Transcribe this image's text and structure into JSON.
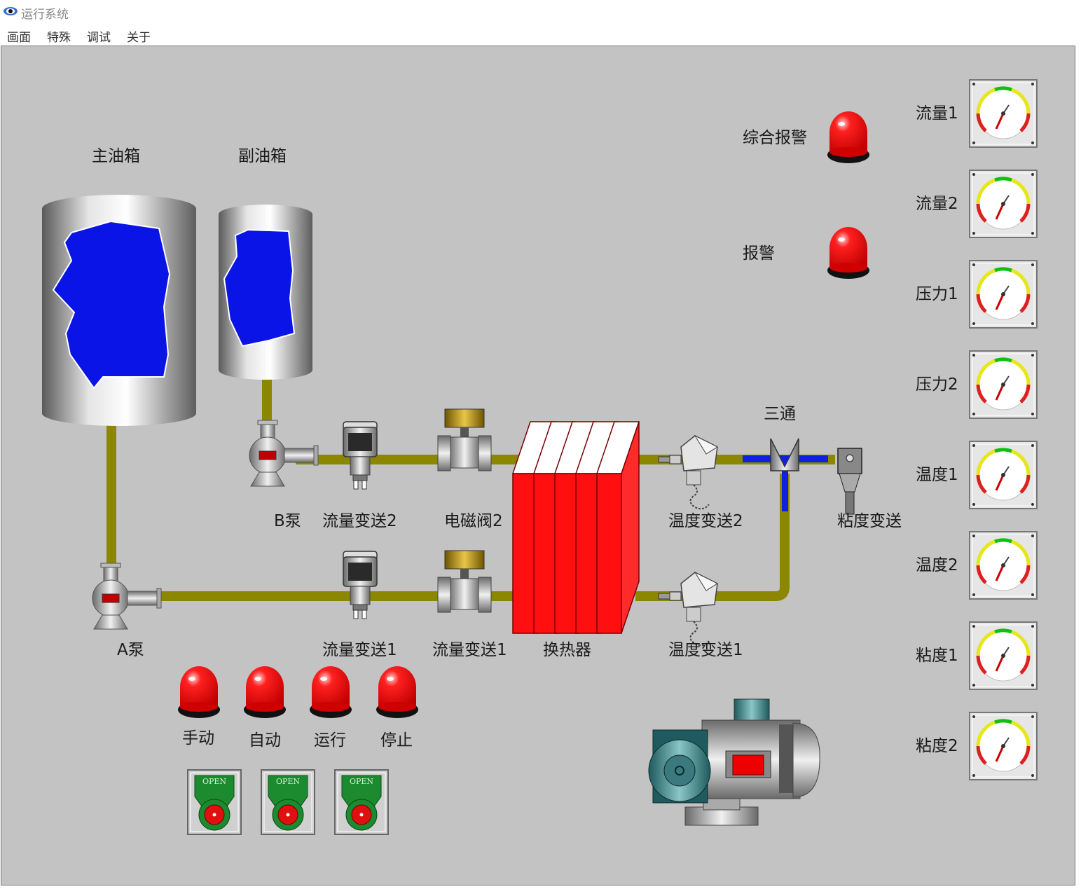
{
  "window": {
    "title": "运行系统"
  },
  "menu": [
    "画面",
    "特殊",
    "调试",
    "关于"
  ],
  "tanks": {
    "main": "主油箱",
    "secondary": "副油箱"
  },
  "pumps": {
    "a": "A泵",
    "b": "B泵"
  },
  "devices": {
    "flow_transmitter_2": "流量变送2",
    "solenoid_valve_2": "电磁阀2",
    "temp_transmitter_2": "温度变送2",
    "tee": "三通",
    "viscosity_transmitter": "粘度变送",
    "flow_transmitter_1": "流量变送1",
    "flow_transmitter_1b": "流量变送1",
    "heat_exchanger": "换热器",
    "temp_transmitter_1": "温度变送1"
  },
  "alarms": {
    "general": "综合报警",
    "alarm": "报警"
  },
  "lamps": [
    "手动",
    "自动",
    "运行",
    "停止"
  ],
  "buttons": {
    "label": "OPEN"
  },
  "gauges": [
    "流量1",
    "流量2",
    "压力1",
    "压力2",
    "温度1",
    "温度2",
    "粘度1",
    "粘度2"
  ],
  "colors": {
    "pipe": "#8c8700",
    "liquid": "#0a14e6",
    "lamp": "#ff0000",
    "exchanger": "#ff0f0f",
    "canvas": "#c3c3c3"
  }
}
